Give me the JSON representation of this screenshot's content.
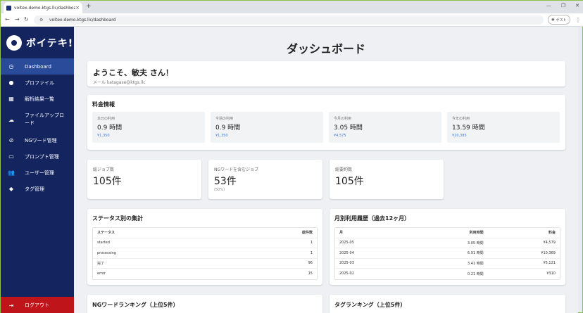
{
  "browser": {
    "tab_title": "voitex-demo.ktgs.llc/dashboard",
    "tab_close": "×",
    "new_tab": "+",
    "url": "voitex-demo.ktgs.llc/dashboard",
    "guest_label": "ゲスト",
    "controls": [
      "—",
      "❐",
      "✕"
    ]
  },
  "sidebar": {
    "logo_text": "ボイテキ!",
    "items": [
      {
        "label": "Dashboard",
        "icon": "clock-icon",
        "glyph": "◷"
      },
      {
        "label": "プロファイル",
        "icon": "person-icon",
        "glyph": "●"
      },
      {
        "label": "解析結果一覧",
        "icon": "table-icon",
        "glyph": "▦"
      },
      {
        "label": "ファイルアップロード",
        "icon": "cloud-upload-icon",
        "glyph": "☁"
      },
      {
        "label": "NGワード管理",
        "icon": "block-icon",
        "glyph": "⊘"
      },
      {
        "label": "プロンプト管理",
        "icon": "chat-icon",
        "glyph": "▭"
      },
      {
        "label": "ユーザー管理",
        "icon": "people-icon",
        "glyph": "👥"
      },
      {
        "label": "タグ管理",
        "icon": "tag-icon",
        "glyph": "◆"
      }
    ],
    "logout_label": "ログアウト",
    "logout_glyph": "⇥"
  },
  "main": {
    "title": "ダッシュボード",
    "welcome": "ようこそ、敏夫 さん！",
    "email_line": "メール  katagase@ktgs.llc",
    "fees": {
      "title": "料金情報",
      "items": [
        {
          "label": "本日の利用",
          "hours": "0.9 時間",
          "yen": "¥1,350"
        },
        {
          "label": "今週の利用",
          "hours": "0.9 時間",
          "yen": "¥1,350"
        },
        {
          "label": "今月の利用",
          "hours": "3.05 時間",
          "yen": "¥4,575"
        },
        {
          "label": "今年の利用",
          "hours": "13.59 時間",
          "yen": "¥20,385"
        }
      ]
    },
    "stats": [
      {
        "label": "総ジョブ数",
        "value": "105件",
        "sub": ""
      },
      {
        "label": "NGワードを含むジョブ",
        "value": "53件",
        "sub": "(50%)"
      },
      {
        "label": "総要約数",
        "value": "105件",
        "sub": ""
      }
    ],
    "status_summary": {
      "title": "ステータス別の集計",
      "headers": [
        "ステータス",
        "総件数"
      ],
      "rows": [
        [
          "started",
          "1"
        ],
        [
          "processing",
          "1"
        ],
        [
          "完了",
          "96"
        ],
        [
          "error",
          "15"
        ]
      ]
    },
    "monthly": {
      "title": "月別利用履歴（過去12ヶ月）",
      "headers": [
        "月",
        "利用時間",
        "料金"
      ],
      "rows": [
        [
          "2025-05",
          "3.05 時間",
          "¥4,579"
        ],
        [
          "2025-04",
          "6.91 時間",
          "¥10,369"
        ],
        [
          "2025-03",
          "3.41 時間",
          "¥5,121"
        ],
        [
          "2025-02",
          "0.21 時間",
          "¥310"
        ]
      ]
    },
    "ng_ranking_title": "NGワードランキング（上位5件）",
    "tag_ranking_title": "タグランキング（上位5件）"
  }
}
